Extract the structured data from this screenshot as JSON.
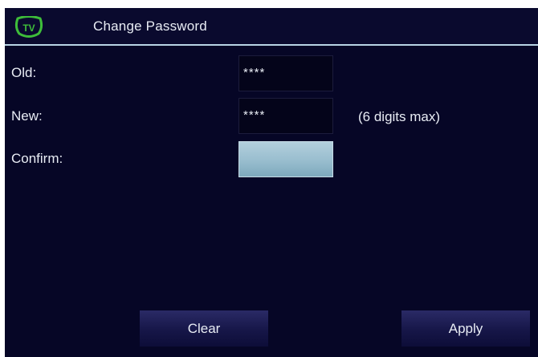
{
  "header": {
    "title": "Change Password",
    "logo_icon": "tv-logo-icon",
    "logo_text": "TV"
  },
  "form": {
    "old": {
      "label": "Old:",
      "value": "****"
    },
    "new": {
      "label": "New:",
      "value": "****",
      "hint": "(6 digits max)"
    },
    "confirm": {
      "label": "Confirm:",
      "value": ""
    }
  },
  "buttons": {
    "clear_label": "Clear",
    "apply_label": "Apply"
  },
  "colors": {
    "background": "#060626",
    "title_divider": "#b8d4e4",
    "logo_accent": "#3ebd3a",
    "active_field": "#9bbfd0",
    "button": "#161648"
  }
}
